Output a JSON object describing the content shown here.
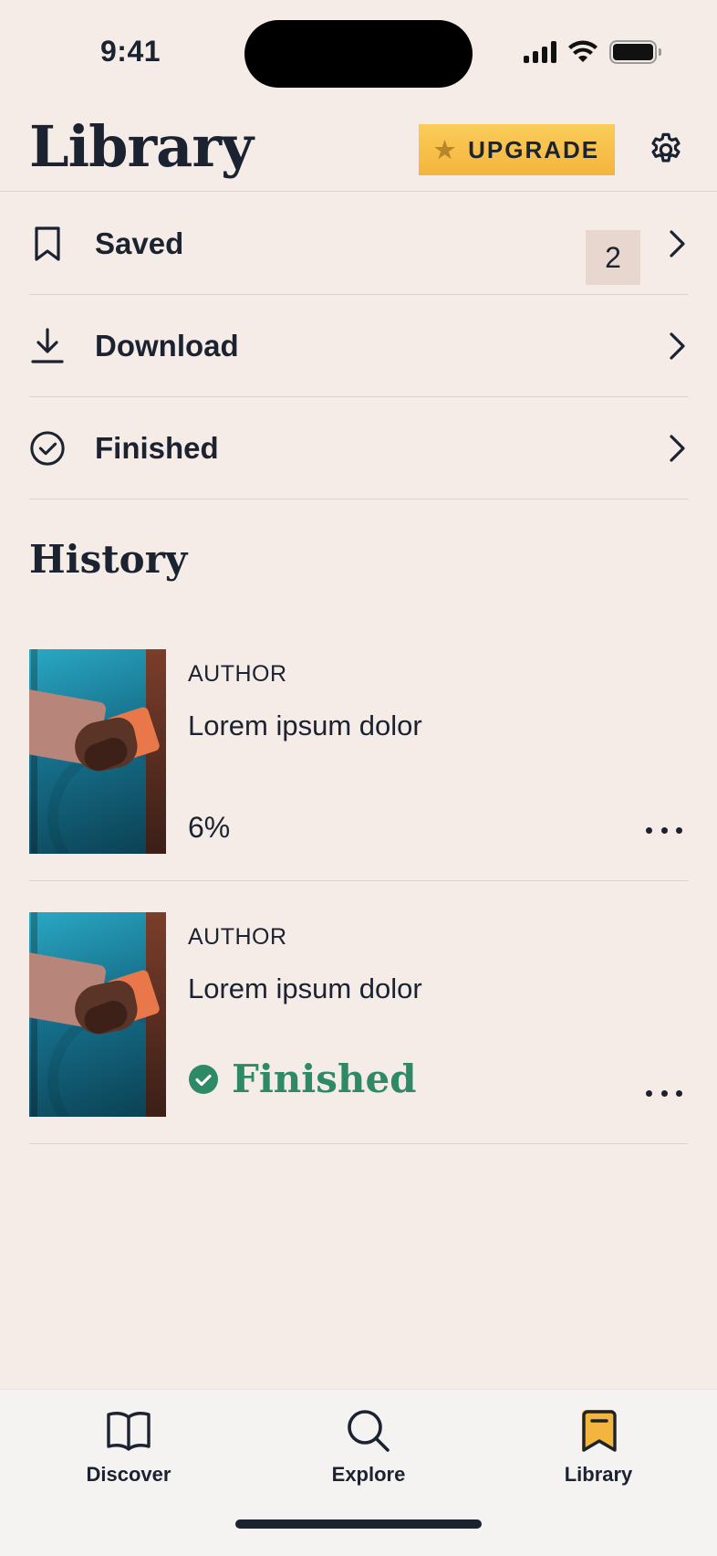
{
  "status_bar": {
    "time": "9:41"
  },
  "header": {
    "title": "Library",
    "upgrade_label": "UPGRADE"
  },
  "menu": [
    {
      "label": "Saved",
      "icon": "bookmark-icon",
      "count": "2"
    },
    {
      "label": "Download",
      "icon": "download-icon"
    },
    {
      "label": "Finished",
      "icon": "check-circle-icon"
    }
  ],
  "history": {
    "title": "History",
    "items": [
      {
        "author": "AUTHOR",
        "title": "Lorem ipsum dolor",
        "progress": "6%"
      },
      {
        "author": "AUTHOR",
        "title": "Lorem ipsum dolor",
        "status": "Finished"
      }
    ]
  },
  "tabs": [
    {
      "label": "Discover",
      "icon": "book-open-icon"
    },
    {
      "label": "Explore",
      "icon": "search-icon"
    },
    {
      "label": "Library",
      "icon": "library-bookmark-icon",
      "active": true
    }
  ],
  "colors": {
    "background": "#f5ebe7",
    "accent": "#f3b53d",
    "finished": "#2e8a66",
    "text": "#1b2230"
  }
}
